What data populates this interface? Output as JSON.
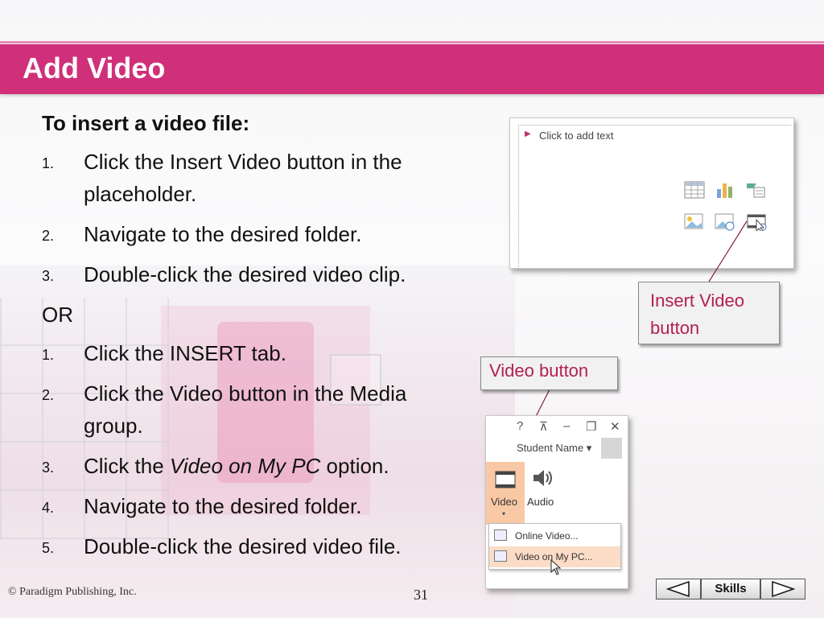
{
  "slide": {
    "title": "Add Video",
    "heading": "To insert a video file:",
    "list_a": [
      {
        "num": "1.",
        "text": "Click the Insert Video button in the placeholder."
      },
      {
        "num": "2.",
        "text": "Navigate to the desired folder."
      },
      {
        "num": "3.",
        "text": "Double-click the desired video clip."
      }
    ],
    "or_text": "OR",
    "list_b": [
      {
        "num": "1.",
        "text": "Click the INSERT tab."
      },
      {
        "num": "2.",
        "text": "Click the Video button in the Media group."
      },
      {
        "num": "3.",
        "text_before": "Click the ",
        "text_italic": "Video on My PC",
        "text_after": " option."
      },
      {
        "num": "4.",
        "text": "Navigate to the desired folder."
      },
      {
        "num": "5.",
        "text": "Double-click the desired video file."
      }
    ]
  },
  "screenshot1": {
    "placeholder_text": "Click to add text"
  },
  "callouts": {
    "insert_video": "Insert Video button",
    "video_button": "Video button"
  },
  "screenshot2": {
    "window_controls": [
      "?",
      "⊼",
      "–",
      "❐",
      "✕"
    ],
    "student_name": "Student Name ▾",
    "video_label": "Video",
    "audio_label": "Audio",
    "menu_items": [
      "Online Video...",
      "Video on My PC..."
    ]
  },
  "footer": {
    "copyright": "© Paradigm Publishing, Inc.",
    "page_number": "31",
    "nav_skills": "Skills"
  },
  "colors": {
    "header": "#d0307a",
    "callout_text": "#b3204e"
  }
}
